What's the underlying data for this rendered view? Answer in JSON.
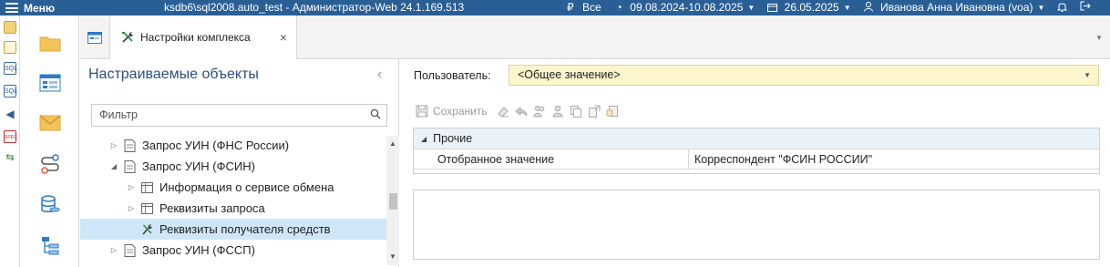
{
  "topbar": {
    "menu_label": "Меню",
    "title": "ksdb6\\sql2008.auto_test - Администратор-Web 24.1.169.513",
    "currency": "Все",
    "period": "09.08.2024-10.08.2025",
    "date": "26.05.2025",
    "user": "Иванова Анна Ивановна (voa)"
  },
  "left_strip": {
    "icons": [
      "publish-icon",
      "doc-icon",
      "sql-icon",
      "sql-icon",
      "announce-icon",
      "spec-icon",
      "transfer-icon"
    ],
    "sql_text": "SQL",
    "spec_text": "SPEC"
  },
  "sidenav": {
    "icons": [
      "folder-icon",
      "form-icon",
      "mail-icon",
      "route-icon",
      "database-icon",
      "tree-icon"
    ]
  },
  "tabs": {
    "active_label": "Настройки комплекса",
    "close": "×"
  },
  "tree_panel": {
    "title": "Настраиваемые объекты",
    "collapse": "‹",
    "filter_placeholder": "Фильтр",
    "nodes": [
      {
        "label": "Запрос УИН (ФНС России)",
        "toggle": "▷"
      },
      {
        "label": "Запрос УИН (ФСИН)",
        "toggle": "◢"
      },
      {
        "label": "Информация о сервисе обмена",
        "toggle": "▷"
      },
      {
        "label": "Реквизиты запроса",
        "toggle": "▷"
      },
      {
        "label": "Реквизиты получателя средств",
        "toggle": ""
      },
      {
        "label": "Запрос УИН (ФССП)",
        "toggle": "▷"
      }
    ]
  },
  "right_panel": {
    "user_label": "Пользователь:",
    "user_value": "<Общее значение>",
    "save_label": "Сохранить",
    "group_label": "Прочие",
    "row": {
      "name": "Отобранное значение",
      "value": "Корреспондент \"ФСИН РОССИИ\""
    }
  },
  "colors": {
    "topbar": "#2a5f96",
    "selection": "#cfe6f6",
    "user_select_bg": "#fdf5cc",
    "panel_title": "#2a4f7a"
  }
}
